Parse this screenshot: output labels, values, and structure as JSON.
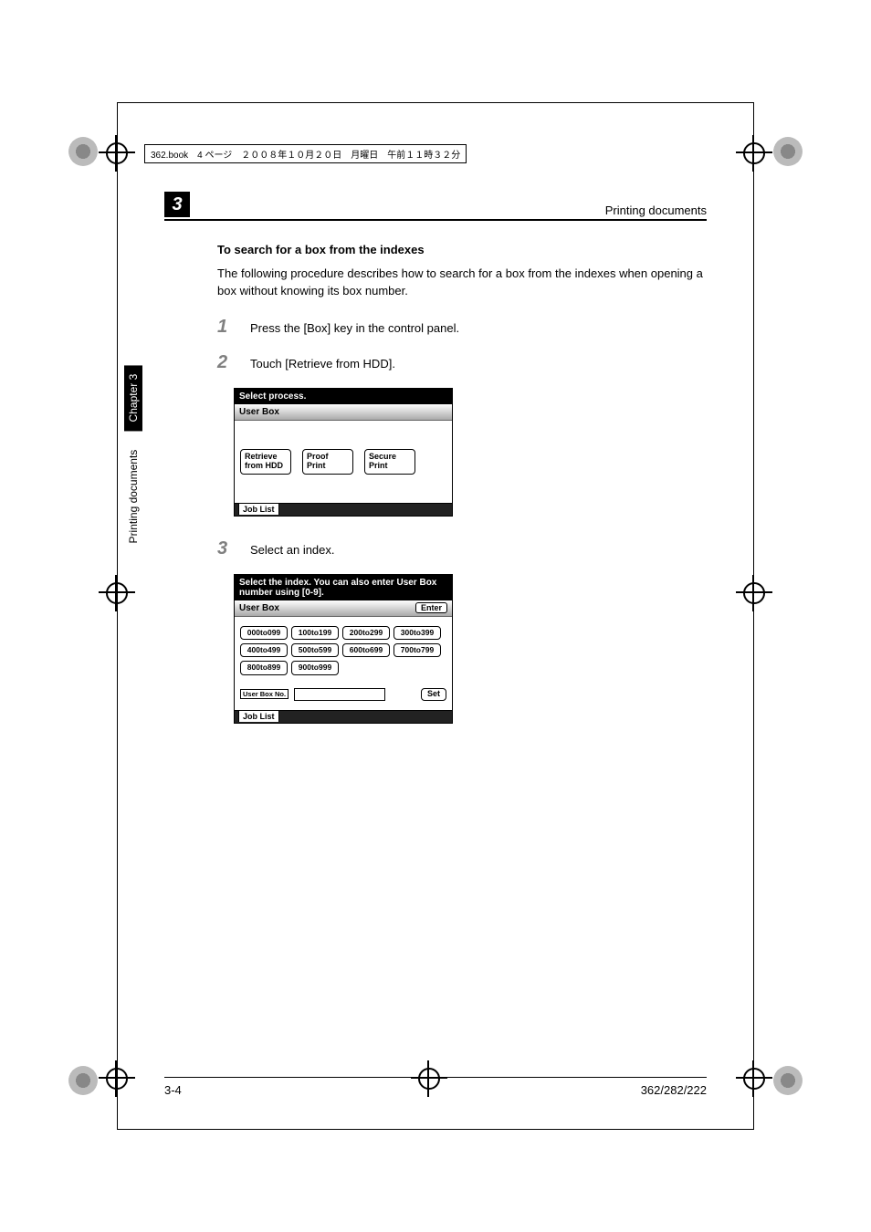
{
  "meta": {
    "file_info": "362.book　4 ページ　２００８年１０月２０日　月曜日　午前１１時３２分"
  },
  "header": {
    "chapter_num": "3",
    "title": "Printing documents"
  },
  "sidetab": {
    "chapter_label": "Chapter 3",
    "section_label": "Printing documents"
  },
  "content": {
    "heading": "To search for a box from the indexes",
    "intro": "The following procedure describes how to search for a box from the indexes when opening a box without knowing its box number.",
    "steps": {
      "s1": {
        "num": "1",
        "text": "Press the [Box] key in the control panel."
      },
      "s2": {
        "num": "2",
        "text": "Touch [Retrieve from HDD]."
      },
      "s3": {
        "num": "3",
        "text": "Select an index."
      }
    }
  },
  "screen1": {
    "title": "Select process.",
    "tab": "User Box",
    "buttons": {
      "retrieve": "Retrieve from HDD",
      "proof": "Proof Print",
      "secure": "Secure Print"
    },
    "footer_tab": "Job List"
  },
  "screen2": {
    "title": "Select the index. You can also enter User Box number using [0-9].",
    "tab": "User Box",
    "enter": "Enter",
    "indexes": [
      "000to099",
      "100to199",
      "200to299",
      "300to399",
      "400to499",
      "500to599",
      "600to699",
      "700to799",
      "800to899",
      "900to999"
    ],
    "ubno": "User Box No.",
    "set": "Set",
    "footer_tab": "Job List"
  },
  "footer": {
    "page_num": "3-4",
    "model": "362/282/222"
  }
}
